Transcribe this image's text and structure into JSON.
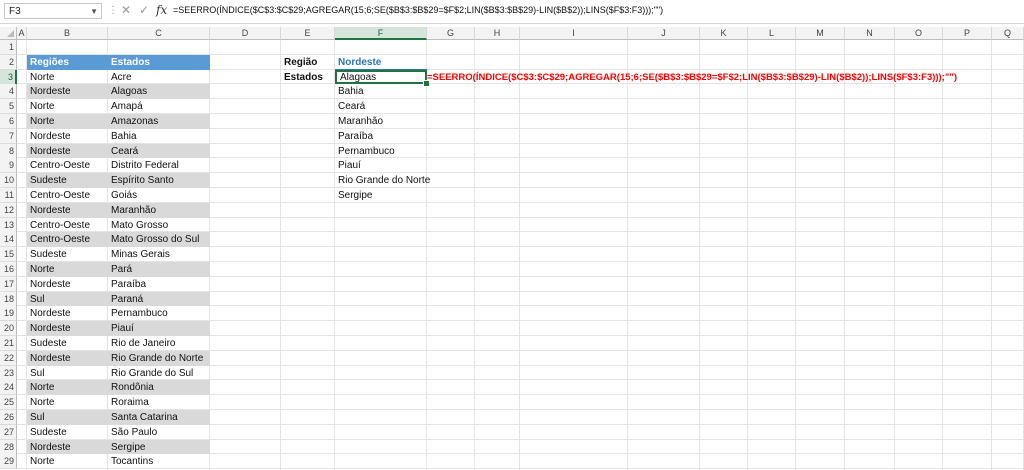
{
  "formula_bar": {
    "name_box": "F3",
    "formula": "=SEERRO(ÍNDICE($C$3:$C$29;AGREGAR(15;6;SE($B$3:$B$29=$F$2;LIN($B$3:$B$29)-LIN($B$2));LINS($F$3:F3)));\"\")",
    "fx_label": "fx",
    "cancel_icon": "✕",
    "enter_icon": "✓"
  },
  "columns": [
    "A",
    "B",
    "C",
    "D",
    "E",
    "F",
    "G",
    "H",
    "I",
    "J",
    "K",
    "L",
    "M",
    "N",
    "O",
    "P",
    "Q"
  ],
  "rows": [
    "1",
    "2",
    "3",
    "4",
    "5",
    "6",
    "7",
    "8",
    "9",
    "10",
    "11",
    "12",
    "13",
    "14",
    "15",
    "16",
    "17",
    "18",
    "19",
    "20",
    "21",
    "22",
    "23",
    "24",
    "25",
    "26",
    "27",
    "28",
    "29"
  ],
  "table": {
    "header_regioes": "Regiões",
    "header_estados": "Estados",
    "rows": [
      [
        "Norte",
        "Acre"
      ],
      [
        "Nordeste",
        "Alagoas"
      ],
      [
        "Norte",
        "Amapá"
      ],
      [
        "Norte",
        "Amazonas"
      ],
      [
        "Nordeste",
        "Bahia"
      ],
      [
        "Nordeste",
        "Ceará"
      ],
      [
        "Centro-Oeste",
        "Distrito Federal"
      ],
      [
        "Sudeste",
        "Espírito Santo"
      ],
      [
        "Centro-Oeste",
        "Goiás"
      ],
      [
        "Nordeste",
        "Maranhão"
      ],
      [
        "Centro-Oeste",
        "Mato Grosso"
      ],
      [
        "Centro-Oeste",
        "Mato Grosso do Sul"
      ],
      [
        "Sudeste",
        "Minas Gerais"
      ],
      [
        "Norte",
        "Pará"
      ],
      [
        "Nordeste",
        "Paraíba"
      ],
      [
        "Sul",
        "Paraná"
      ],
      [
        "Nordeste",
        "Pernambuco"
      ],
      [
        "Nordeste",
        "Piauí"
      ],
      [
        "Sudeste",
        "Rio de Janeiro"
      ],
      [
        "Nordeste",
        "Rio Grande do Norte"
      ],
      [
        "Sul",
        "Rio Grande do Sul"
      ],
      [
        "Norte",
        "Rondônia"
      ],
      [
        "Norte",
        "Roraima"
      ],
      [
        "Sul",
        "Santa Catarina"
      ],
      [
        "Sudeste",
        "São Paulo"
      ],
      [
        "Nordeste",
        "Sergipe"
      ],
      [
        "Norte",
        "Tocantins"
      ]
    ]
  },
  "lookup": {
    "regiao_label": "Região",
    "regiao_value": "Nordeste",
    "estados_label": "Estados",
    "results": [
      "Alagoas",
      "Bahia",
      "Ceará",
      "Maranhão",
      "Paraíba",
      "Pernambuco",
      "Piauí",
      "Rio Grande do Norte",
      "Sergipe"
    ]
  },
  "formula_annotation": "=SEERRO(ÍNDICE($C$3:$C$29;AGREGAR(15;6;SE($B$3:$B$29=$F$2;LIN($B$3:$B$29)-LIN($B$2));LINS($F$3:F3)));\"\")",
  "colors": {
    "table_header": "#5b9bd5",
    "band": "#d9d9d9",
    "selection": "#217346",
    "formula_red": "#ff0000"
  }
}
